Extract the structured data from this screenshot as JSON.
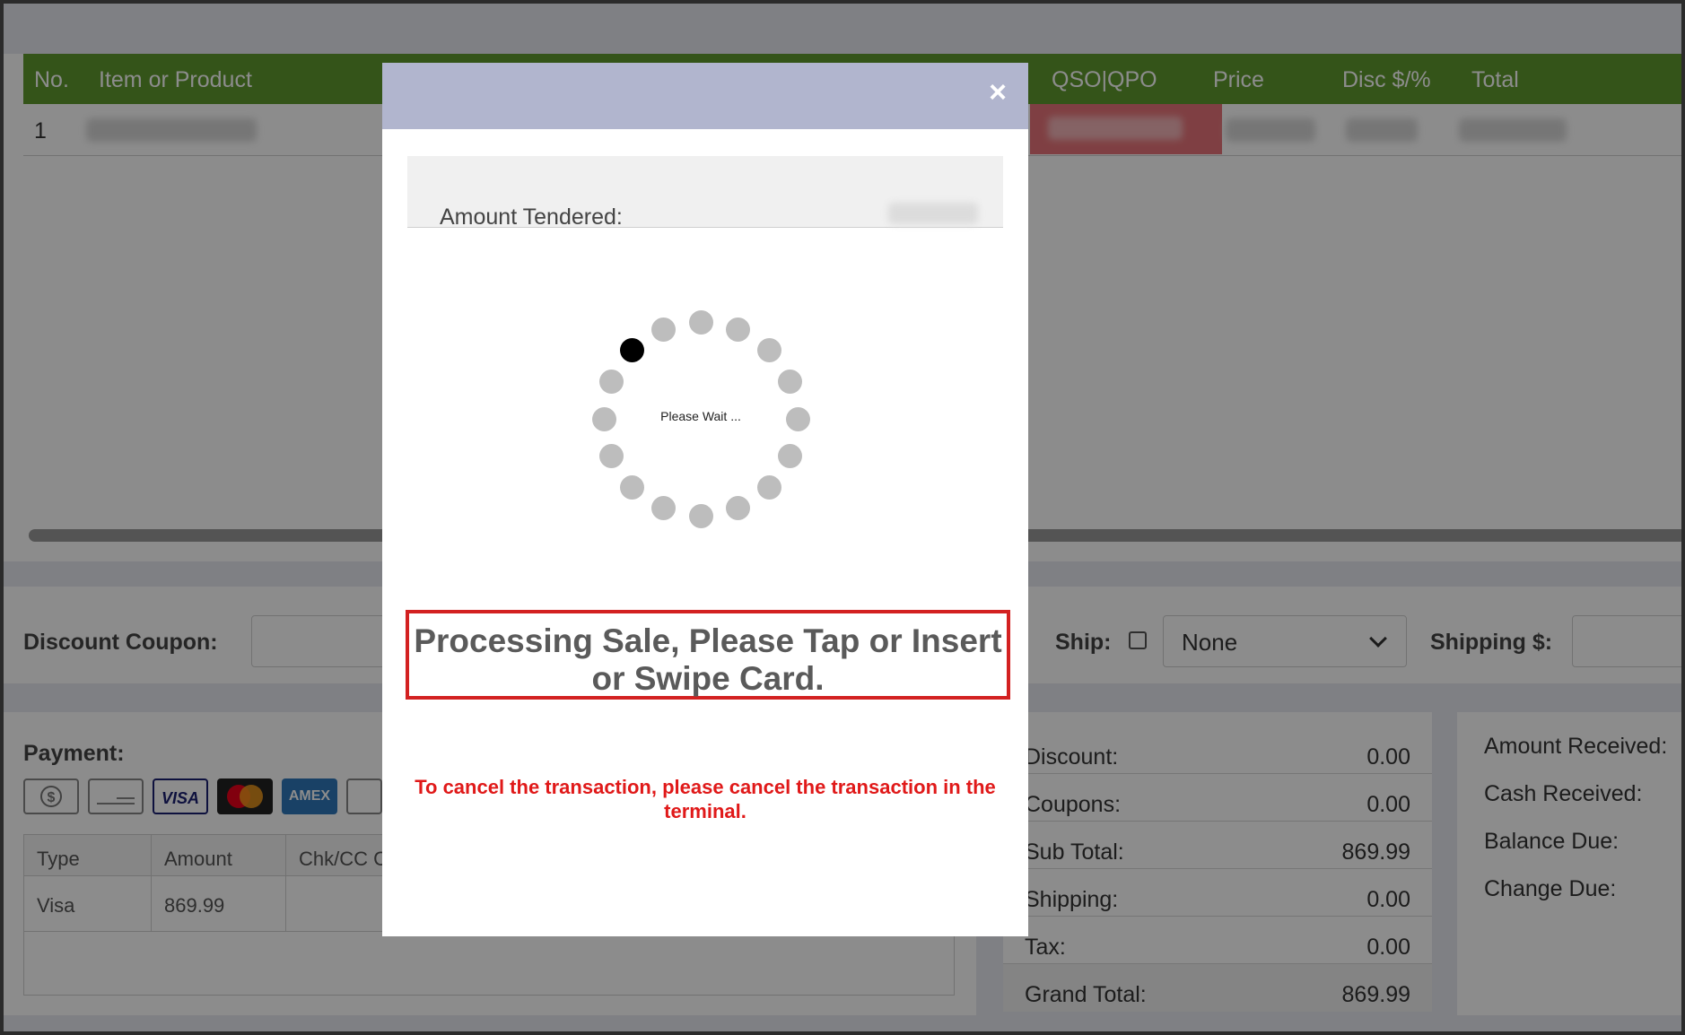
{
  "grid": {
    "headers": [
      "No.",
      "Item or Product",
      "QSO|QPO",
      "Price",
      "Disc $/%",
      "Total"
    ],
    "rows": [
      {
        "no": "1"
      }
    ]
  },
  "coupon": {
    "label": "Discount Coupon:",
    "value": ""
  },
  "ship": {
    "label": "Ship:",
    "checked": false,
    "method": "None",
    "shipping_label": "Shipping $:",
    "shipping_value": ""
  },
  "payment": {
    "title": "Payment:",
    "icons": [
      "cash-icon",
      "check-icon",
      "visa-icon",
      "mastercard-icon",
      "amex-icon",
      "card-icon"
    ],
    "icon_text": {
      "visa": "VISA",
      "mastercard": "MasterCard",
      "amex": "AMEX"
    },
    "table": {
      "headers": [
        "Type",
        "Amount",
        "Chk/CC C"
      ],
      "rows": [
        {
          "type": "Visa",
          "amount": "869.99"
        }
      ]
    }
  },
  "totals": [
    {
      "label": "Discount:",
      "value": "0.00"
    },
    {
      "label": "Coupons:",
      "value": "0.00"
    },
    {
      "label": "Sub Total:",
      "value": "869.99"
    },
    {
      "label": "Shipping:",
      "value": "0.00"
    },
    {
      "label": "Tax:",
      "value": "0.00"
    },
    {
      "label": "Grand Total:",
      "value": "869.99"
    }
  ],
  "received": [
    "Amount Received:",
    "Cash Received:",
    "Balance Due:",
    "Change Due:"
  ],
  "modal": {
    "close": "×",
    "tender_label": "Amount Tendered:",
    "spinner_text": "Please Wait ...",
    "spinner_dots": 16,
    "spinner_active_index": 14,
    "processing_text": "Processing Sale, Please Tap or Insert or Swipe Card.",
    "cancel_note": "To cancel the transaction, please cancel the transaction in the terminal."
  },
  "colors": {
    "header_green": "#5f9a2e",
    "modal_header": "#b1b5ce",
    "processing_border": "#d32121",
    "cancel_text": "#e01919",
    "spinner_dot": "#bdbdbd",
    "spinner_active": "#000000"
  }
}
